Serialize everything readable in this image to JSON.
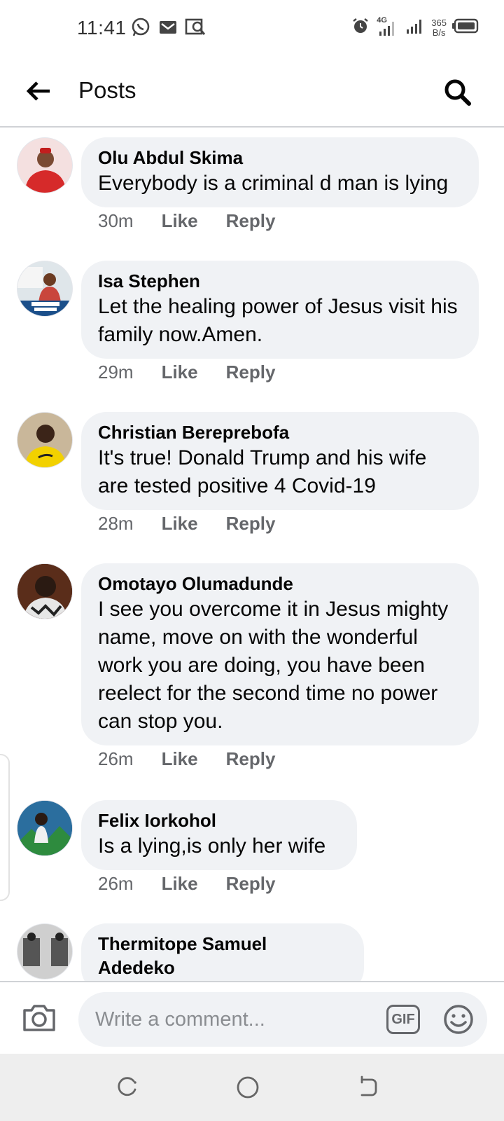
{
  "status_bar": {
    "time": "11:41",
    "left_icons": [
      "whatsapp-icon",
      "gmail-icon",
      "gallery-search-icon"
    ],
    "network": "4G",
    "speed_value": "365",
    "speed_unit": "B/s"
  },
  "header": {
    "title": "Posts",
    "back_icon": "arrow-left-icon",
    "search_icon": "search-icon"
  },
  "comments": [
    {
      "author": "Olu Abdul Skima",
      "text": "Everybody is a criminal d man is lying",
      "time": "30m",
      "like_label": "Like",
      "reply_label": "Reply",
      "avatar_color": "#d62a2a"
    },
    {
      "author": "Isa Stephen",
      "text": "Let the healing power of Jesus visit his family now.Amen.",
      "time": "29m",
      "like_label": "Like",
      "reply_label": "Reply",
      "avatar_color": "#5a8fb8"
    },
    {
      "author": "Christian Bereprebofa",
      "text": "It's true! Donald Trump and his wife are tested positive 4 Covid-19",
      "time": "28m",
      "like_label": "Like",
      "reply_label": "Reply",
      "avatar_color": "#f2d100"
    },
    {
      "author": "Omotayo Olumadunde",
      "text": "I see you overcome it in Jesus mighty name, move on with the wonderful work you are doing, you have been reelect for the second time no power can stop you.",
      "time": "26m",
      "like_label": "Like",
      "reply_label": "Reply",
      "avatar_color": "#3a2a22"
    },
    {
      "author": "Felix Iorkohol",
      "text": "Is a lying,is only her wife",
      "time": "26m",
      "like_label": "Like",
      "reply_label": "Reply",
      "avatar_color": "#2b6e9e"
    },
    {
      "author": "Thermitope Samuel Adedeko",
      "text": "",
      "avatar_color": "#555555"
    }
  ],
  "composer": {
    "placeholder": "Write a comment...",
    "gif_label": "GIF",
    "camera_icon": "camera-icon",
    "emoji_icon": "emoji-icon"
  },
  "nav": {
    "icons": [
      "recent-apps-icon",
      "home-icon",
      "back-icon"
    ]
  }
}
